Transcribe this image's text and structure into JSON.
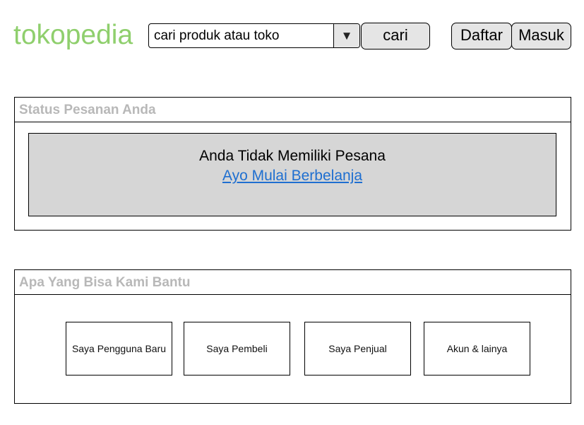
{
  "header": {
    "logo_text": "tokopedia",
    "logo_color": "#8fcf6d",
    "search": {
      "value": "cari produk atau toko",
      "dropdown_icon": "triangle-down-icon"
    },
    "search_button_label": "cari",
    "register_button_label": "Daftar",
    "login_button_label": "Masuk"
  },
  "order_status": {
    "title": "Status Pesanan Anda",
    "empty_message": "Anda Tidak Memiliki Pesana",
    "start_shopping_link": "Ayo Mulai Berbelanja"
  },
  "help": {
    "title": "Apa Yang Bisa Kami Bantu",
    "items": [
      {
        "label": "Saya Pengguna Baru"
      },
      {
        "label": "Saya Pembeli"
      },
      {
        "label": "Saya Penjual"
      },
      {
        "label": "Akun & lainya"
      }
    ]
  },
  "colors": {
    "panel_title": "#b8b8b8",
    "link": "#1f6fd0",
    "button_bg": "#e5e5e5",
    "empty_box_bg": "#d6d6d6"
  }
}
